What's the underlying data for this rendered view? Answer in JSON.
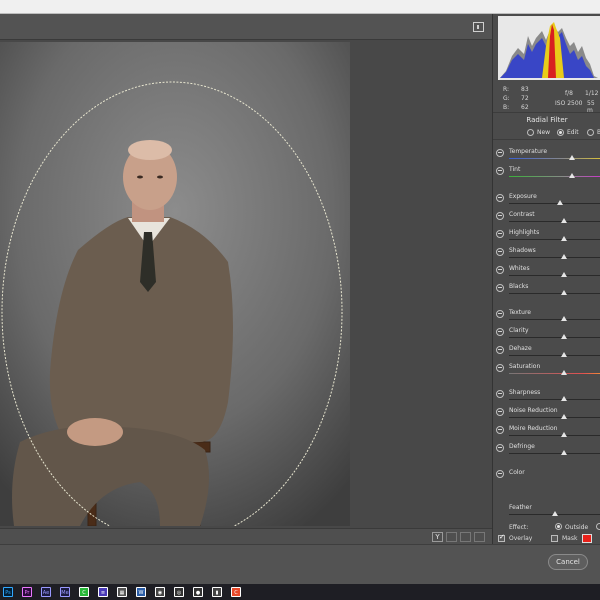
{
  "toolbar": {
    "export_icon": "export-icon"
  },
  "readout": {
    "r_label": "R:",
    "r_value": "83",
    "g_label": "G:",
    "g_value": "72",
    "b_label": "B:",
    "b_value": "62",
    "aperture": "f/8",
    "shutter": "1/12",
    "iso": "ISO 2500",
    "focal": "55 m"
  },
  "panel": {
    "title": "Radial Filter",
    "modes": [
      "New",
      "Edit",
      "B"
    ],
    "sliders": {
      "temperature": {
        "label": "Temperature",
        "value": 0.68
      },
      "tint": {
        "label": "Tint",
        "value": 0.68
      },
      "exposure": {
        "label": "Exposure",
        "value": 0.55
      },
      "contrast": {
        "label": "Contrast",
        "value": 0.6
      },
      "highlights": {
        "label": "Highlights",
        "value": 0.6
      },
      "shadows": {
        "label": "Shadows",
        "value": 0.6
      },
      "whites": {
        "label": "Whites",
        "value": 0.6
      },
      "blacks": {
        "label": "Blacks",
        "value": 0.6
      },
      "texture": {
        "label": "Texture",
        "value": 0.6
      },
      "clarity": {
        "label": "Clarity",
        "value": 0.6
      },
      "dehaze": {
        "label": "Dehaze",
        "value": 0.6
      },
      "saturation": {
        "label": "Saturation",
        "value": 0.6
      },
      "sharpness": {
        "label": "Sharpness",
        "value": 0.6
      },
      "noise_reduction": {
        "label": "Noise Reduction",
        "value": 0.6
      },
      "moire_reduction": {
        "label": "Moire Reduction",
        "value": 0.6
      },
      "defringe": {
        "label": "Defringe",
        "value": 0.6
      }
    },
    "color_label": "Color",
    "feather": {
      "label": "Feather",
      "value": 0.5
    },
    "effect_label": "Effect:",
    "effect_options": [
      "Outside",
      ""
    ],
    "overlay_label": "Overlay",
    "mask_label": "Mask",
    "mask_color": "#e8211a"
  },
  "status": {
    "y_button": "Y"
  },
  "footer": {
    "cancel_label": "Cancel"
  },
  "taskbar": {
    "apps": [
      {
        "name": "Ps",
        "color": "#31a8ff",
        "bg": "#001e36"
      },
      {
        "name": "Pr",
        "color": "#ea77ff",
        "bg": "#2a0a3a"
      },
      {
        "name": "Ae",
        "color": "#9999ff",
        "bg": "#1c1c40"
      },
      {
        "name": "Me",
        "color": "#9999ff",
        "bg": "#1c1c40"
      },
      {
        "name": "C",
        "color": "#fff",
        "bg": "#28b838"
      },
      {
        "name": "≡",
        "color": "#fff",
        "bg": "#4a3ab8"
      },
      {
        "name": "▦",
        "color": "#fff",
        "bg": "#555"
      },
      {
        "name": "W",
        "color": "#fff",
        "bg": "#2b5ea8"
      },
      {
        "name": "◉",
        "color": "#fff",
        "bg": "#444"
      },
      {
        "name": "◎",
        "color": "#fff",
        "bg": "#333"
      },
      {
        "name": "●",
        "color": "#fff",
        "bg": "#333"
      },
      {
        "name": "▮",
        "color": "#fff",
        "bg": "#444"
      },
      {
        "name": "C",
        "color": "#fff",
        "bg": "#e8492a"
      }
    ]
  }
}
